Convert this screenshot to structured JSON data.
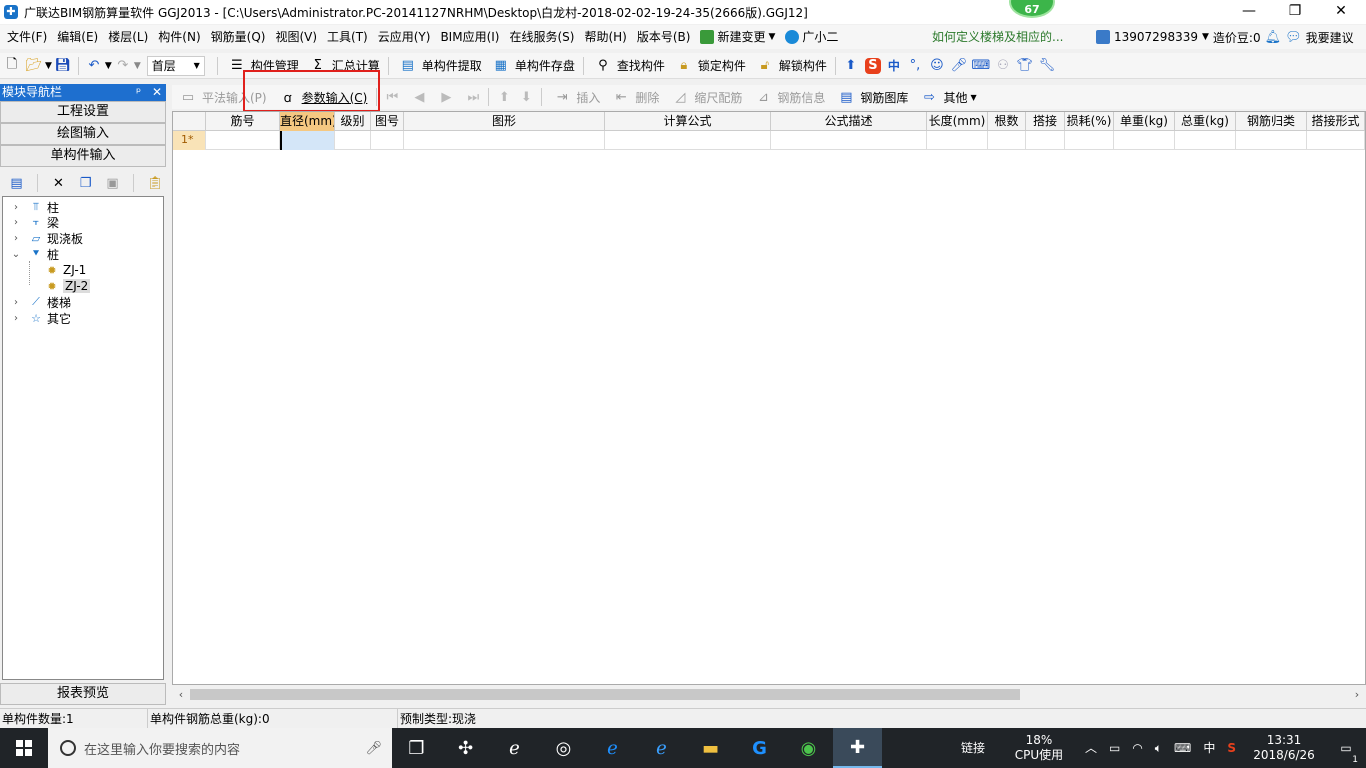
{
  "window": {
    "title": "广联达BIM钢筋算量软件 GGJ2013 - [C:\\Users\\Administrator.PC-20141127NRHM\\Desktop\\白龙村-2018-02-02-19-24-35(2666版).GGJ12]",
    "badge": "67",
    "minimize": "—",
    "restore": "❐",
    "close": "✕"
  },
  "menu": {
    "items": [
      "文件(F)",
      "编辑(E)",
      "楼层(L)",
      "构件(N)",
      "钢筋量(Q)",
      "视图(V)",
      "工具(T)",
      "云应用(Y)",
      "BIM应用(I)",
      "在线服务(S)",
      "帮助(H)",
      "版本号(B)"
    ],
    "new_change": "新建变更",
    "assistant": "广小二",
    "hint": "如何定义楼梯及相应的...",
    "phone": "13907298339",
    "beans": "造价豆:0",
    "suggest": "我要建议"
  },
  "toolbar1": {
    "floor": "首层",
    "buttons": [
      "构件管理",
      "汇总计算",
      "单构件提取",
      "单构件存盘",
      "查找构件",
      "锁定构件",
      "解锁构件"
    ],
    "ime_mode": "中"
  },
  "nav": {
    "title": "模块导航栏",
    "pin": "ᵖ",
    "close": "✕",
    "tabs": [
      "工程设置",
      "绘图输入",
      "单构件输入"
    ],
    "report_tab": "报表预览",
    "tree": [
      {
        "label": "柱",
        "icon": "column-icon",
        "expanded": false
      },
      {
        "label": "梁",
        "icon": "beam-icon",
        "expanded": false
      },
      {
        "label": "现浇板",
        "icon": "slab-icon",
        "expanded": false
      },
      {
        "label": "桩",
        "icon": "pile-icon",
        "expanded": true
      },
      {
        "label": "ZJ-1",
        "icon": "gear-icon",
        "child": true
      },
      {
        "label": "ZJ-2",
        "icon": "gear-icon",
        "child": true,
        "selected": true
      },
      {
        "label": "楼梯",
        "icon": "stairs-icon",
        "expanded": false
      },
      {
        "label": "其它",
        "icon": "star-icon",
        "expanded": false
      }
    ]
  },
  "grid_toolbar": {
    "flat_input": "平法输入(P)",
    "param_input": "参数输入(C)",
    "insert": "插入",
    "delete": "删除",
    "scale_rebar": "缩尺配筋",
    "rebar_info": "钢筋信息",
    "rebar_library": "钢筋图库",
    "other": "其他"
  },
  "grid": {
    "columns": [
      "",
      "筋号",
      "直径(mm)",
      "级别",
      "图号",
      "图形",
      "计算公式",
      "公式描述",
      "长度(mm)",
      "根数",
      "搭接",
      "损耗(%)",
      "单重(kg)",
      "总重(kg)",
      "钢筋归类",
      "搭接形式"
    ],
    "rows": [
      {
        "num": "1*"
      }
    ]
  },
  "status": {
    "count": "单构件数量:1",
    "weight": "单构件钢筋总重(kg):0",
    "prefab": "预制类型:现浇"
  },
  "taskbar": {
    "search_placeholder": "在这里输入你要搜索的内容",
    "link": "链接",
    "cpu_pct": "18%",
    "cpu_label": "CPU使用",
    "ime": "中",
    "time": "13:31",
    "date": "2018/6/26",
    "notif": "1"
  }
}
